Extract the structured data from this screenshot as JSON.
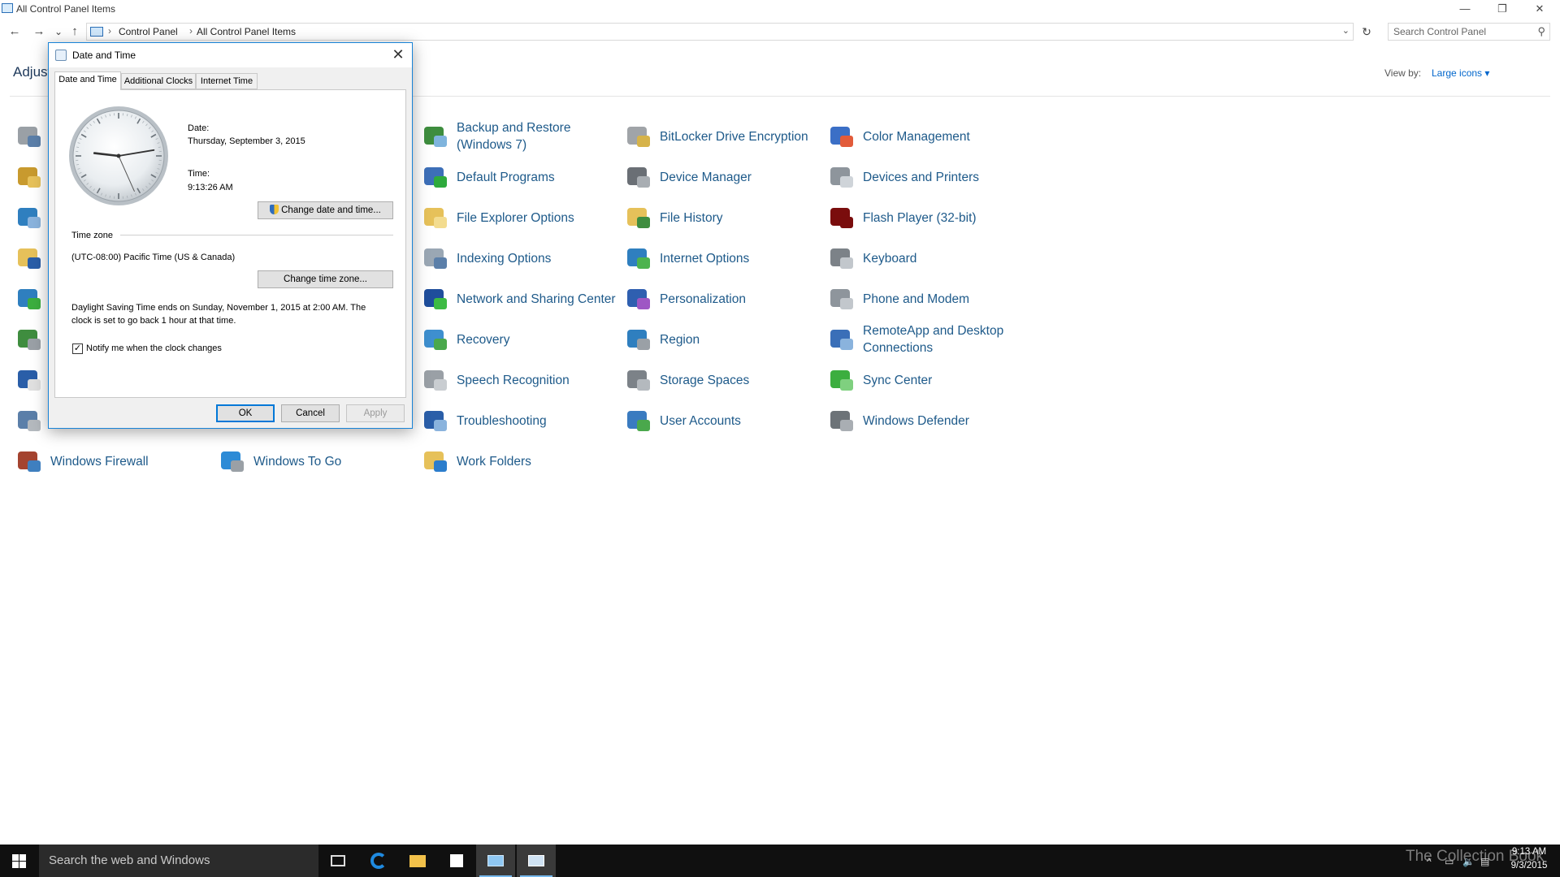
{
  "window": {
    "title": "All Control Panel Items",
    "minimize": "—",
    "restore": "❐",
    "close": "✕"
  },
  "nav": {
    "back": "←",
    "forward": "→",
    "recent": "⌄",
    "up": "↑"
  },
  "address": {
    "crumbs": [
      "Control Panel",
      "All Control Panel Items"
    ],
    "separator": "›",
    "dropdown": "⌄",
    "refresh": "↻"
  },
  "search": {
    "placeholder": "Search Control Panel",
    "icon": "⚲"
  },
  "header": {
    "title": "Adjust",
    "view_by_label": "View by:",
    "view_by_value": "Large icons ▾"
  },
  "items": {
    "col3": [
      {
        "label": "Backup and Restore (Windows 7)",
        "icon": "backup-restore-icon",
        "c1": "#3e8d3e",
        "c2": "#7fb4dd"
      },
      {
        "label": "Default Programs",
        "icon": "default-programs-icon",
        "c1": "#3d6fb8",
        "c2": "#2eaa3d"
      },
      {
        "label": "File Explorer Options",
        "icon": "folder-options-icon",
        "c1": "#e6c15a",
        "c2": "#f3dc8f"
      },
      {
        "label": "Indexing Options",
        "icon": "indexing-icon",
        "c1": "#9aa7b4",
        "c2": "#5b7fa9"
      },
      {
        "label": "Network and Sharing Center",
        "icon": "network-icon",
        "c1": "#1f4e9c",
        "c2": "#3dbb44"
      },
      {
        "label": "Recovery",
        "icon": "recovery-icon",
        "c1": "#3e8fcf",
        "c2": "#4aa84c"
      },
      {
        "label": "Speech Recognition",
        "icon": "microphone-icon",
        "c1": "#9aa0a6",
        "c2": "#c9cdd1"
      },
      {
        "label": "Troubleshooting",
        "icon": "troubleshooting-icon",
        "c1": "#2a5ea8",
        "c2": "#8ab3dd"
      },
      {
        "label": "Work Folders",
        "icon": "work-folders-icon",
        "c1": "#e6c15a",
        "c2": "#2b7dcc"
      }
    ],
    "col4": [
      {
        "label": "BitLocker Drive Encryption",
        "icon": "bitlocker-icon",
        "c1": "#a0a4a8",
        "c2": "#d6b34a"
      },
      {
        "label": "Device Manager",
        "icon": "device-manager-icon",
        "c1": "#6a6f75",
        "c2": "#a8adb2"
      },
      {
        "label": "File History",
        "icon": "file-history-icon",
        "c1": "#e6c15a",
        "c2": "#3f8d3f"
      },
      {
        "label": "Internet Options",
        "icon": "internet-options-icon",
        "c1": "#2f7fbf",
        "c2": "#4db34f"
      },
      {
        "label": "Personalization",
        "icon": "personalization-icon",
        "c1": "#2f5fb0",
        "c2": "#9e57c4"
      },
      {
        "label": "Region",
        "icon": "region-icon",
        "c1": "#2f7fbf",
        "c2": "#9aa0a6"
      },
      {
        "label": "Storage Spaces",
        "icon": "storage-spaces-icon",
        "c1": "#7c8288",
        "c2": "#b4b9be"
      },
      {
        "label": "User Accounts",
        "icon": "user-accounts-icon",
        "c1": "#3a7bc0",
        "c2": "#4aa84c"
      }
    ],
    "col5": [
      {
        "label": "Color Management",
        "icon": "color-management-icon",
        "c1": "#3b6fc6",
        "c2": "#e25b3a"
      },
      {
        "label": "Devices and Printers",
        "icon": "printer-icon",
        "c1": "#8e959c",
        "c2": "#cfd4d9"
      },
      {
        "label": "Flash Player (32-bit)",
        "icon": "flash-player-icon",
        "c1": "#7a0d0d",
        "c2": "#7a0d0d"
      },
      {
        "label": "Keyboard",
        "icon": "keyboard-icon",
        "c1": "#7c8288",
        "c2": "#c2c7cc"
      },
      {
        "label": "Phone and Modem",
        "icon": "phone-modem-icon",
        "c1": "#8e959c",
        "c2": "#c2c7cc"
      },
      {
        "label": "RemoteApp and Desktop Connections",
        "icon": "remoteapp-icon",
        "c1": "#3a6fb8",
        "c2": "#8ab3dd"
      },
      {
        "label": "Sync Center",
        "icon": "sync-center-icon",
        "c1": "#3cae3f",
        "c2": "#7fd07f"
      },
      {
        "label": "Windows Defender",
        "icon": "windows-defender-icon",
        "c1": "#6d7378",
        "c2": "#a9aeb3"
      }
    ],
    "col1_bottom": {
      "label": "Windows Firewall",
      "icon": "firewall-icon",
      "c1": "#a4432f",
      "c2": "#3f7fbf"
    },
    "col2_bottom": {
      "label": "Windows To Go",
      "icon": "windows-to-go-icon",
      "c1": "#2d8bd6",
      "c2": "#9aa0a6"
    },
    "left_icons": [
      {
        "icon": "administrative-tools-icon",
        "c1": "#9aa0a6",
        "c2": "#5b7fa9"
      },
      {
        "icon": "credential-manager-icon",
        "c1": "#c89a2e",
        "c2": "#e6c15a"
      },
      {
        "icon": "display-icon",
        "c1": "#2f7fbf",
        "c2": "#8ab3dd"
      },
      {
        "icon": "fonts-icon",
        "c1": "#e6c15a",
        "c2": "#2a5ea8"
      },
      {
        "icon": "language-icon",
        "c1": "#2f7fbf",
        "c2": "#3cae3f"
      },
      {
        "icon": "programs-features-icon",
        "c1": "#3f8d3f",
        "c2": "#9aa0a6"
      },
      {
        "icon": "security-maintenance-icon",
        "c1": "#2a5ea8",
        "c2": "#e0e0e0"
      },
      {
        "icon": "system-icon",
        "c1": "#5b7fa9",
        "c2": "#b4b9be"
      }
    ]
  },
  "dialog": {
    "title": "Date and Time",
    "close": "✕",
    "tabs": [
      "Date and Time",
      "Additional Clocks",
      "Internet Time"
    ],
    "date_label": "Date:",
    "date_value": "Thursday, September 3, 2015",
    "time_label": "Time:",
    "time_value": "9:13:26 AM",
    "change_datetime": "Change date and time...",
    "timezone_section": "Time zone",
    "timezone_value": "(UTC-08:00) Pacific Time (US & Canada)",
    "change_timezone": "Change time zone...",
    "dst_line1": "Daylight Saving Time ends on Sunday, November 1, 2015 at 2:00 AM. The",
    "dst_line2": "clock is set to go back 1 hour at that time.",
    "notify_label": "Notify me when the clock changes",
    "notify_mark": "✓",
    "ok": "OK",
    "cancel": "Cancel",
    "apply": "Apply",
    "clock": {
      "hour": 9,
      "minute": 13,
      "second": 26
    }
  },
  "taskbar": {
    "search_placeholder": "Search the web and Windows",
    "watermark": "The Collection Book",
    "tray_time": "9:13 AM",
    "tray_date": "9/3/2015",
    "tray_icons": [
      "^",
      "▭",
      "🔈",
      "▤"
    ]
  }
}
